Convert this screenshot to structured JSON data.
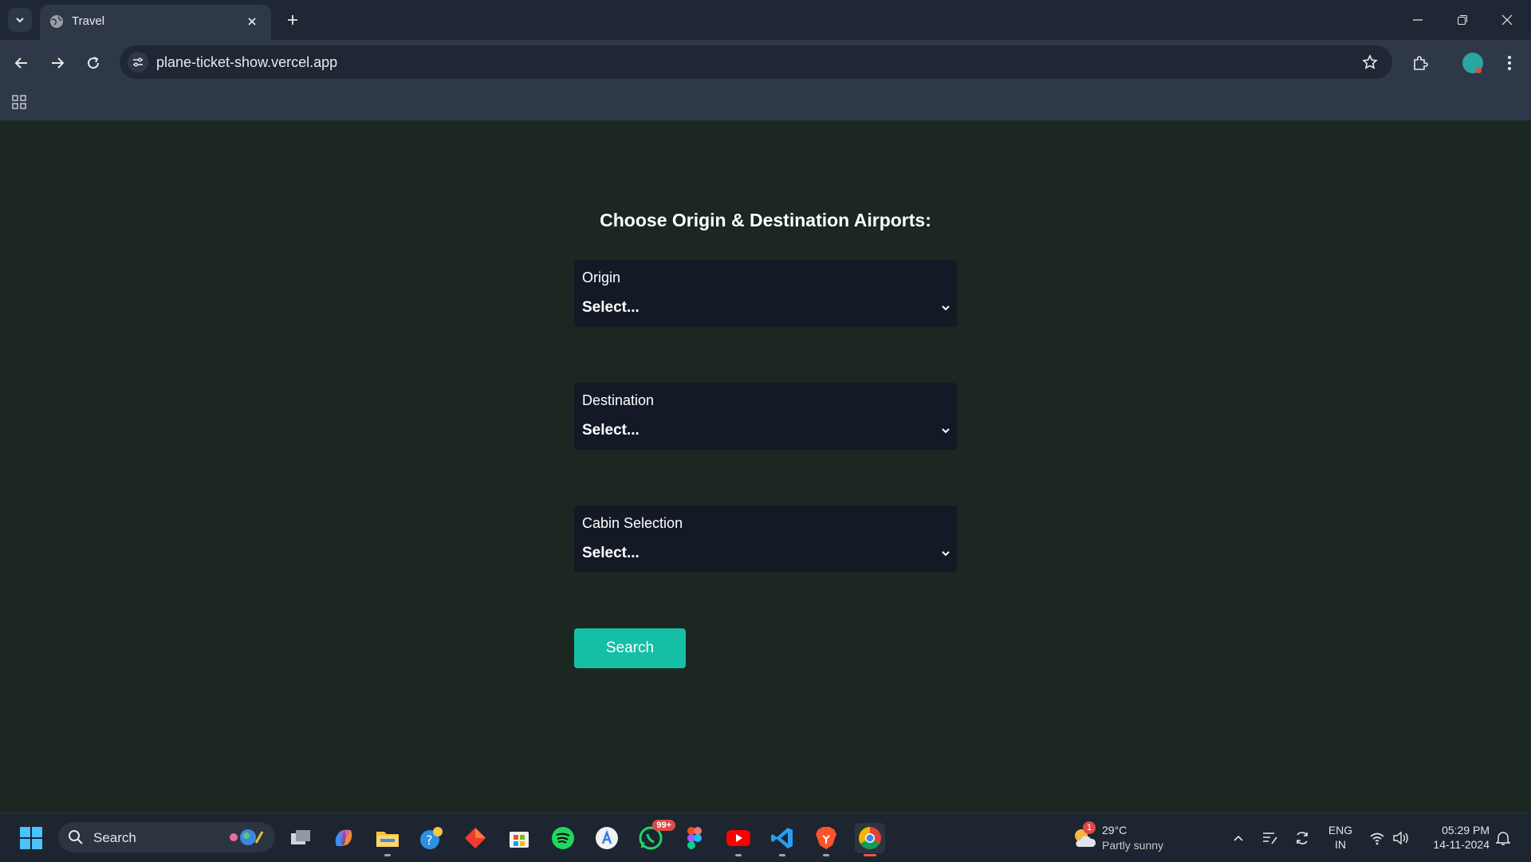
{
  "browser": {
    "tab_title": "Travel",
    "url": "plane-ticket-show.vercel.app"
  },
  "page": {
    "heading": "Choose Origin & Destination Airports:",
    "fields": [
      {
        "label": "Origin",
        "value": "Select..."
      },
      {
        "label": "Destination",
        "value": "Select..."
      },
      {
        "label": "Cabin Selection",
        "value": "Select..."
      }
    ],
    "search_button": "Search"
  },
  "taskbar": {
    "search_label": "Search",
    "whatsapp_badge": "99+",
    "weather": {
      "badge": "1",
      "temp": "29°C",
      "condition": "Partly sunny"
    },
    "lang": {
      "line1": "ENG",
      "line2": "IN"
    },
    "clock": {
      "time": "05:29 PM",
      "date": "14-11-2024"
    }
  },
  "colors": {
    "page_bg": "#1b2720",
    "field_bg": "#131a26",
    "accent": "#14bfa6",
    "chrome_bg": "#1e2733",
    "toolbar_bg": "#2e3848"
  },
  "icons": [
    "tab-search-icon",
    "globe-icon",
    "close-icon",
    "plus-icon",
    "minimize-icon",
    "restore-icon",
    "back-icon",
    "forward-icon",
    "reload-icon",
    "site-info-icon",
    "star-icon",
    "extensions-icon",
    "profile-avatar",
    "menu-icon",
    "apps-grid-icon",
    "chevron-down-icon",
    "windows-icon",
    "search-icon"
  ]
}
